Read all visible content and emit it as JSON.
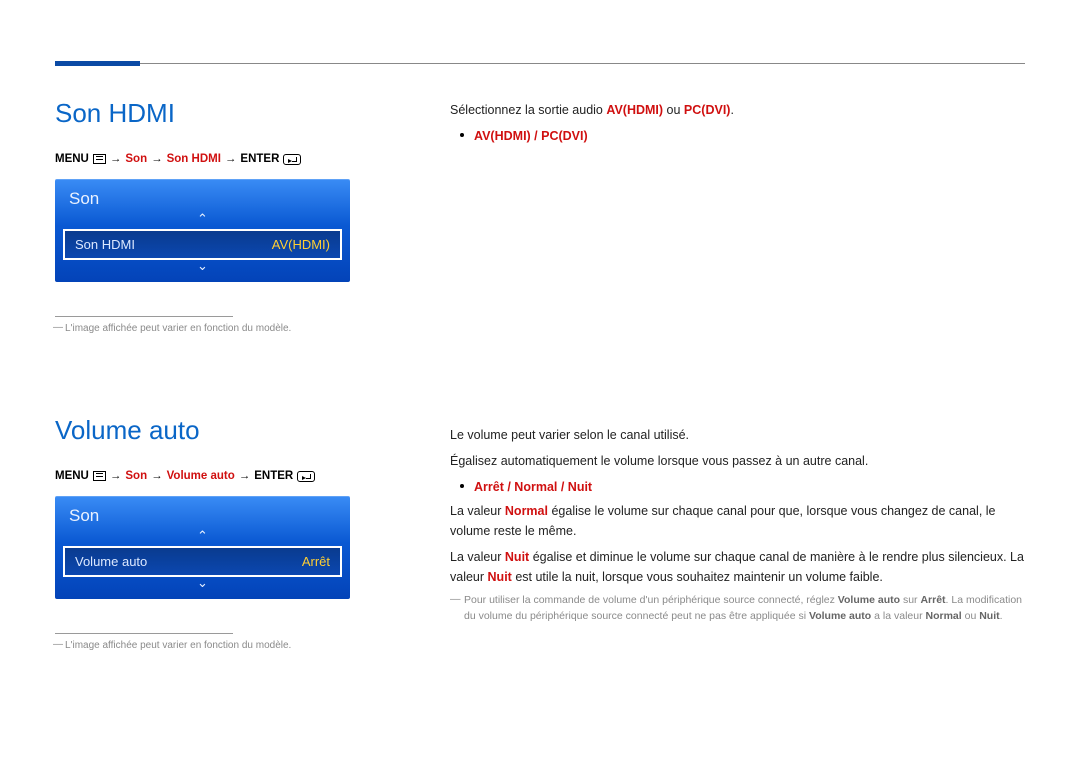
{
  "section1": {
    "title": "Son HDMI",
    "breadcrumb": {
      "menu": "MENU",
      "p1": "Son",
      "p2": "Son HDMI",
      "enter": "ENTER"
    },
    "osd": {
      "title": "Son",
      "row_label": "Son HDMI",
      "row_value": "AV(HDMI)"
    },
    "note": "L'image affichée peut varier en fonction du modèle.",
    "body": {
      "intro_prefix": "Sélectionnez la sortie audio ",
      "opt1": "AV(HDMI)",
      "mid": " ou ",
      "opt2": "PC(DVI)",
      "suffix": ".",
      "bullet_a": "AV(HDMI)",
      "slash": " / ",
      "bullet_b": "PC(DVI)"
    }
  },
  "section2": {
    "title": "Volume auto",
    "breadcrumb": {
      "menu": "MENU",
      "p1": "Son",
      "p2": "Volume auto",
      "enter": "ENTER"
    },
    "osd": {
      "title": "Son",
      "row_label": "Volume auto",
      "row_value": "Arrêt"
    },
    "note": "L'image affichée peut varier en fonction du modèle.",
    "body": {
      "p1": "Le volume peut varier selon le canal utilisé.",
      "p2": "Égalisez automatiquement le volume lorsque vous passez à un autre canal.",
      "bullet_a": "Arrêt",
      "slash1": " / ",
      "bullet_b": "Normal",
      "slash2": " / ",
      "bullet_c": "Nuit",
      "p3_a": "La valeur ",
      "p3_b": "Normal",
      "p3_c": " égalise le volume sur chaque canal pour que, lorsque vous changez de canal, le volume reste le même.",
      "p4_a": "La valeur ",
      "p4_b": "Nuit",
      "p4_c": " égalise et diminue le volume sur chaque canal de manière à le rendre plus silencieux. La valeur ",
      "p4_d": "Nuit",
      "p4_e": " est utile la nuit, lorsque vous souhaitez maintenir un volume faible.",
      "foot_a": "Pour utiliser la commande de volume d'un périphérique source connecté, réglez ",
      "foot_b": "Volume auto",
      "foot_c": " sur ",
      "foot_d": "Arrêt",
      "foot_e": ". La modification du volume du périphérique source connecté peut ne pas être appliquée si ",
      "foot_f": "Volume auto",
      "foot_g": " a la valeur ",
      "foot_h": "Normal",
      "foot_i": " ou ",
      "foot_j": "Nuit",
      "foot_k": "."
    }
  }
}
